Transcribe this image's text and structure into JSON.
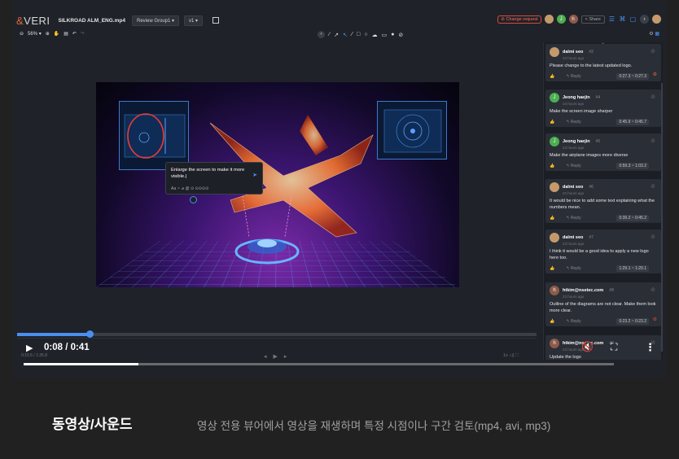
{
  "app": {
    "logo_prefix": "&",
    "logo_text": "VERI"
  },
  "header": {
    "filename": "SILKROAD ALM_ENG.mp4",
    "group_select": "Review Group1 ▾",
    "version_select": "v1 ▾",
    "change_request": "Change request",
    "share": "< Share",
    "avatars": [
      {
        "initial": "",
        "color": "#c49a6c"
      },
      {
        "initial": "J",
        "color": "#4caf50"
      },
      {
        "initial": "h",
        "color": "#8d5a4a"
      }
    ]
  },
  "toolbar": {
    "zoom": "56% ▾"
  },
  "popup": {
    "text": "Enlarge the screen to make it more visible.|",
    "tools": "Aa  ⚬  ⌀  @     ⊙    ⊙⊙⊙⊙"
  },
  "timecode": {
    "left": "0:15.5 / 1:35.8",
    "right": "1x  ◁)  ⛶"
  },
  "player": {
    "time": "0:08 / 0:41",
    "progress": 0.195
  },
  "timeline": {
    "progress": 0.14
  },
  "comments": [
    {
      "name": "dalmi seo",
      "num": "#2",
      "ago": "23 hours ago",
      "body": "Please change to the latest updated logo.",
      "range": "0:27.3 ~ 0:27.3",
      "avatar_initial": "",
      "avatar_color": "#c49a6c",
      "flag_color": "#e06a3a"
    },
    {
      "name": "Jeong haejin",
      "num": "#4",
      "ago": "23 hours ago",
      "body": "Make the screen image sharper",
      "range": "0:45.9 ~ 0:45.7",
      "avatar_initial": "J",
      "avatar_color": "#4caf50",
      "flag_color": ""
    },
    {
      "name": "Jeong haejin",
      "num": "#5",
      "ago": "23 hours ago",
      "body": "Make the airplane images more diverse",
      "range": "0:59.3 ~ 1:03.2",
      "avatar_initial": "J",
      "avatar_color": "#4caf50",
      "flag_color": ""
    },
    {
      "name": "dalmi seo",
      "num": "#6",
      "ago": "23 hours ago",
      "body": "It would be nice to add some text explaining what the numbers mean.",
      "range": "0:39.2 ~ 0:45.2",
      "avatar_initial": "",
      "avatar_color": "#c49a6c",
      "flag_color": ""
    },
    {
      "name": "dalmi seo",
      "num": "#7",
      "ago": "23 hours ago",
      "body": "I think it would be a good idea to apply a new logo here too.",
      "range": "1:29.1 ~ 1:29.1",
      "avatar_initial": "",
      "avatar_color": "#c49a6c",
      "flag_color": ""
    },
    {
      "name": "htkim@nsetec.com",
      "num": "#8",
      "ago": "23 hours ago",
      "body": "Outline of the diagrams are not clear. Make them look more clear.",
      "range": "0:23.2 ~ 0:23.2",
      "avatar_initial": "h",
      "avatar_color": "#8d5a4a",
      "flag_color": "#d9493b"
    },
    {
      "name": "htkim@nsetec.com",
      "num": "#9",
      "ago": "23 hours ago",
      "body": "Update the logo",
      "range": "",
      "avatar_initial": "h",
      "avatar_color": "#8d5a4a",
      "flag_color": ""
    }
  ],
  "reply_label": "↰ Reply",
  "caption": {
    "title": "동영상/사운드",
    "description": "영상 전용 뷰어에서 영상을 재생하며 특정 시점이나 구간 검토(mp4, avi, mp3)"
  }
}
